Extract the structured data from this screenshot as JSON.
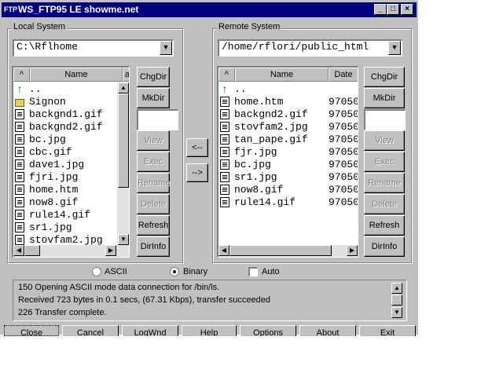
{
  "window": {
    "title": "WS_FTP95 LE showme.net",
    "icon": "FTP"
  },
  "local": {
    "group_label": "Local System",
    "path": "C:\\Rflhome",
    "headers": {
      "sort": "^",
      "name": "Name",
      "extra": "a"
    },
    "files": [
      {
        "icon": "up-icon",
        "name": ".."
      },
      {
        "icon": "folder-icon",
        "name": "Signon"
      },
      {
        "icon": "file-icon",
        "name": "backgnd1.gif"
      },
      {
        "icon": "file-icon",
        "name": "backgnd2.gif"
      },
      {
        "icon": "file-icon",
        "name": "bc.jpg"
      },
      {
        "icon": "file-icon",
        "name": "cbc.gif"
      },
      {
        "icon": "file-icon",
        "name": "dave1.jpg"
      },
      {
        "icon": "file-icon",
        "name": "fjri.jpg"
      },
      {
        "icon": "file-icon",
        "name": "home.htm"
      },
      {
        "icon": "file-icon",
        "name": "now8.gif"
      },
      {
        "icon": "file-icon",
        "name": "rule14.gif"
      },
      {
        "icon": "file-icon",
        "name": "sr1.jpg"
      },
      {
        "icon": "file-icon",
        "name": "stovfam2.jpg"
      }
    ],
    "buttons": {
      "chgdir": "ChgDir",
      "mkdir": "MkDir",
      "view": "View",
      "exec": "Exec",
      "rename": "Rename",
      "delete": "Delete",
      "refresh": "Refresh",
      "dirinfo": "DirInfo"
    }
  },
  "remote": {
    "group_label": "Remote System",
    "path": "/home/rflori/public_html",
    "headers": {
      "sort": "^",
      "name": "Name",
      "date": "Date"
    },
    "files": [
      {
        "icon": "up-icon",
        "name": "..",
        "date": ""
      },
      {
        "icon": "file-icon",
        "name": "home.htm",
        "date": "97050"
      },
      {
        "icon": "file-icon",
        "name": "backgnd2.gif",
        "date": "97050"
      },
      {
        "icon": "file-icon",
        "name": "stovfam2.jpg",
        "date": "97050"
      },
      {
        "icon": "file-icon",
        "name": "tan_pape.gif",
        "date": "97050"
      },
      {
        "icon": "file-icon",
        "name": "fjr.jpg",
        "date": "97050"
      },
      {
        "icon": "file-icon",
        "name": "bc.jpg",
        "date": "97050"
      },
      {
        "icon": "file-icon",
        "name": "sr1.jpg",
        "date": "97050"
      },
      {
        "icon": "file-icon",
        "name": "now8.gif",
        "date": "97050"
      },
      {
        "icon": "file-icon",
        "name": "rule14.gif",
        "date": "97050"
      }
    ],
    "buttons": {
      "chgdir": "ChgDir",
      "mkdir": "MkDir",
      "view": "View",
      "exec": "Exec",
      "rename": "Rename",
      "delete": "Delete",
      "refresh": "Refresh",
      "dirinfo": "DirInfo"
    }
  },
  "transfer": {
    "download": "<--",
    "upload": "-->"
  },
  "mode": {
    "ascii": "ASCII",
    "binary": "Binary",
    "auto": "Auto",
    "selected": "Binary",
    "auto_checked": false
  },
  "log": [
    "150 Opening ASCII mode data connection for /bin/ls.",
    "Received 723 bytes in 0.1 secs, (67.31 Kbps), transfer succeeded",
    "226 Transfer complete."
  ],
  "bottom_buttons": {
    "close": "Close",
    "cancel": "Cancel",
    "logwnd": "LogWnd",
    "help": "Help",
    "options": "Options",
    "about": "About",
    "exit": "Exit"
  }
}
